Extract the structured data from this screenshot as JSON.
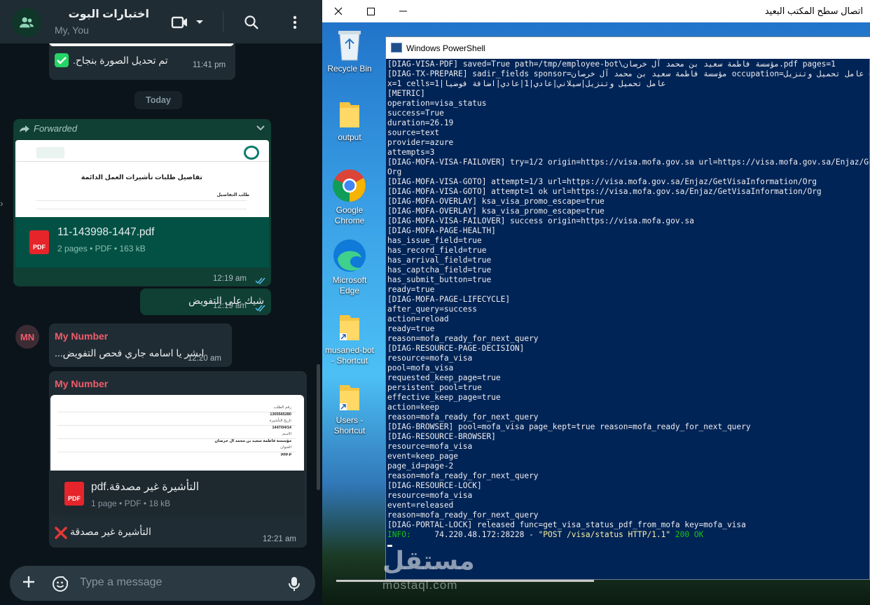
{
  "whatsapp": {
    "header": {
      "title": "اختبارات البوت",
      "subtitle": "My, You"
    },
    "messages": {
      "m1": {
        "text": "تم تحديل الصورة بنجاح.",
        "time": "11:41 pm"
      },
      "day_label": "Today",
      "m2": {
        "forwarded_label": "Forwarded",
        "file_name": "11-143998-1447.pdf",
        "file_meta": "2 pages • PDF • 163 kB",
        "preview_title": "تفاصيل طلبات تأشيرات العمل الدائمة",
        "preview_sub": "طلب التفاصيل",
        "time": "12:19 am"
      },
      "m3": {
        "text": "شيك على التفويض",
        "time": "12:19 am"
      },
      "m4": {
        "sender": "My Number",
        "avatar": "MN",
        "text": "ابشر يا اسامه جاري فحص التفويض...",
        "time": "12:20 am"
      },
      "m5": {
        "sender": "My Number",
        "file_name": "التأشيرة غير مصدقة.pdf",
        "file_meta": "1 page • PDF • 18 kB",
        "preview_lines": [
          "رقم الطلب",
          "1305565280",
          "تاريخ التأشيرة",
          "1447/04/14",
          "الاسم",
          "مؤسسة فاطمة سعيد بن محمد آل خرصان",
          "العنوان",
          "ppp.p"
        ],
        "caption": "التأشيرة غير مصدقة",
        "time": "12:21 am"
      }
    },
    "composer": {
      "placeholder": "Type a message"
    },
    "icon_names": [
      "group-icon",
      "video-icon",
      "chevron-down-icon",
      "search-icon",
      "menu-icon",
      "check-icon",
      "forward-icon",
      "double-check-icon",
      "cross-icon",
      "plus-icon",
      "sticker-icon",
      "mic-icon"
    ]
  },
  "rdp": {
    "title": "اتصال سطح المكتب البعيد",
    "desktop_icons": [
      {
        "label": "Recycle Bin"
      },
      {
        "label": "output"
      },
      {
        "label": "Google Chrome"
      },
      {
        "label": "Microsoft Edge"
      },
      {
        "label": "musaned-bot - Shortcut"
      },
      {
        "label": "Users - Shortcut"
      }
    ],
    "powershell": {
      "title": "Windows PowerShell",
      "lines": [
        "[DIAG-VISA-PDF] saved=True path=/tmp/employee-bot\\مؤسسة فاطمة سعيد بن محمد آل خرصان.pdf pages=1",
        "[DIAG-TX-PREPARE] sadir_fields sponsor=مؤسسة فاطمة سعيد بن محمد آل خرصان occupation=عامل تحميل وتنزيل occupation_title_cells=1",
        "x=1 cells=1|عامل تحميل وتنزيل|سيلاني|عادي|1|عادي|اضافة فوضيا",
        "[METRIC]",
        "operation=visa_status",
        "success=True",
        "duration=26.19",
        "source=text",
        "provider=azure",
        "attempts=3",
        "[DIAG-MOFA-VISA-FAILOVER] try=1/2 origin=https://visa.mofa.gov.sa url=https://visa.mofa.gov.sa/Enjaz/GetVisaInformation/",
        "Org",
        "[DIAG-MOFA-VISA-GOTO] attempt=1/3 url=https://visa.mofa.gov.sa/Enjaz/GetVisaInformation/Org",
        "[DIAG-MOFA-VISA-GOTO] attempt=1 ok url=https://visa.mofa.gov.sa/Enjaz/GetVisaInformation/Org",
        "[DIAG-MOFA-OVERLAY] ksa_visa_promo_escape=true",
        "[DIAG-MOFA-OVERLAY] ksa_visa_promo_escape=true",
        "[DIAG-MOFA-VISA-FAILOVER] success origin=https://visa.mofa.gov.sa",
        "[DIAG-MOFA-PAGE-HEALTH]",
        "has_issue_field=true",
        "has_record_field=true",
        "has_arrival_field=true",
        "has_captcha_field=true",
        "has_submit_button=true",
        "ready=true",
        "[DIAG-MOFA-PAGE-LIFECYCLE]",
        "after_query=success",
        "action=reload",
        "ready=true",
        "reason=mofa_ready_for_next_query",
        "[DIAG-RESOURCE-PAGE-DECISION]",
        "resource=mofa_visa",
        "pool=mofa_visa",
        "requested_keep_page=true",
        "persistent_pool=true",
        "effective_keep_page=true",
        "action=keep",
        "reason=mofa_ready_for_next_query",
        "[DIAG-BROWSER] pool=mofa_visa page_kept=true reason=mofa_ready_for_next_query",
        "[DIAG-RESOURCE-BROWSER]",
        "resource=mofa_visa",
        "event=keep_page",
        "page_id=page-2",
        "reason=mofa_ready_for_next_query",
        "[DIAG-RESOURCE-LOCK]",
        "resource=mofa_visa",
        "event=released",
        "reason=mofa_ready_for_next_query",
        "[DIAG-PORTAL-LOCK] released func=get_visa_status_pdf_from_mofa key=mofa_visa"
      ],
      "last_line": {
        "level": "INFO:",
        "addr": "74.220.48.172:28228 - ",
        "request": "\"POST /visa/status HTTP/1.1\"",
        "status": "200 OK"
      }
    },
    "watermark": {
      "main": "مستقل",
      "sub": "mostaql.com"
    }
  }
}
